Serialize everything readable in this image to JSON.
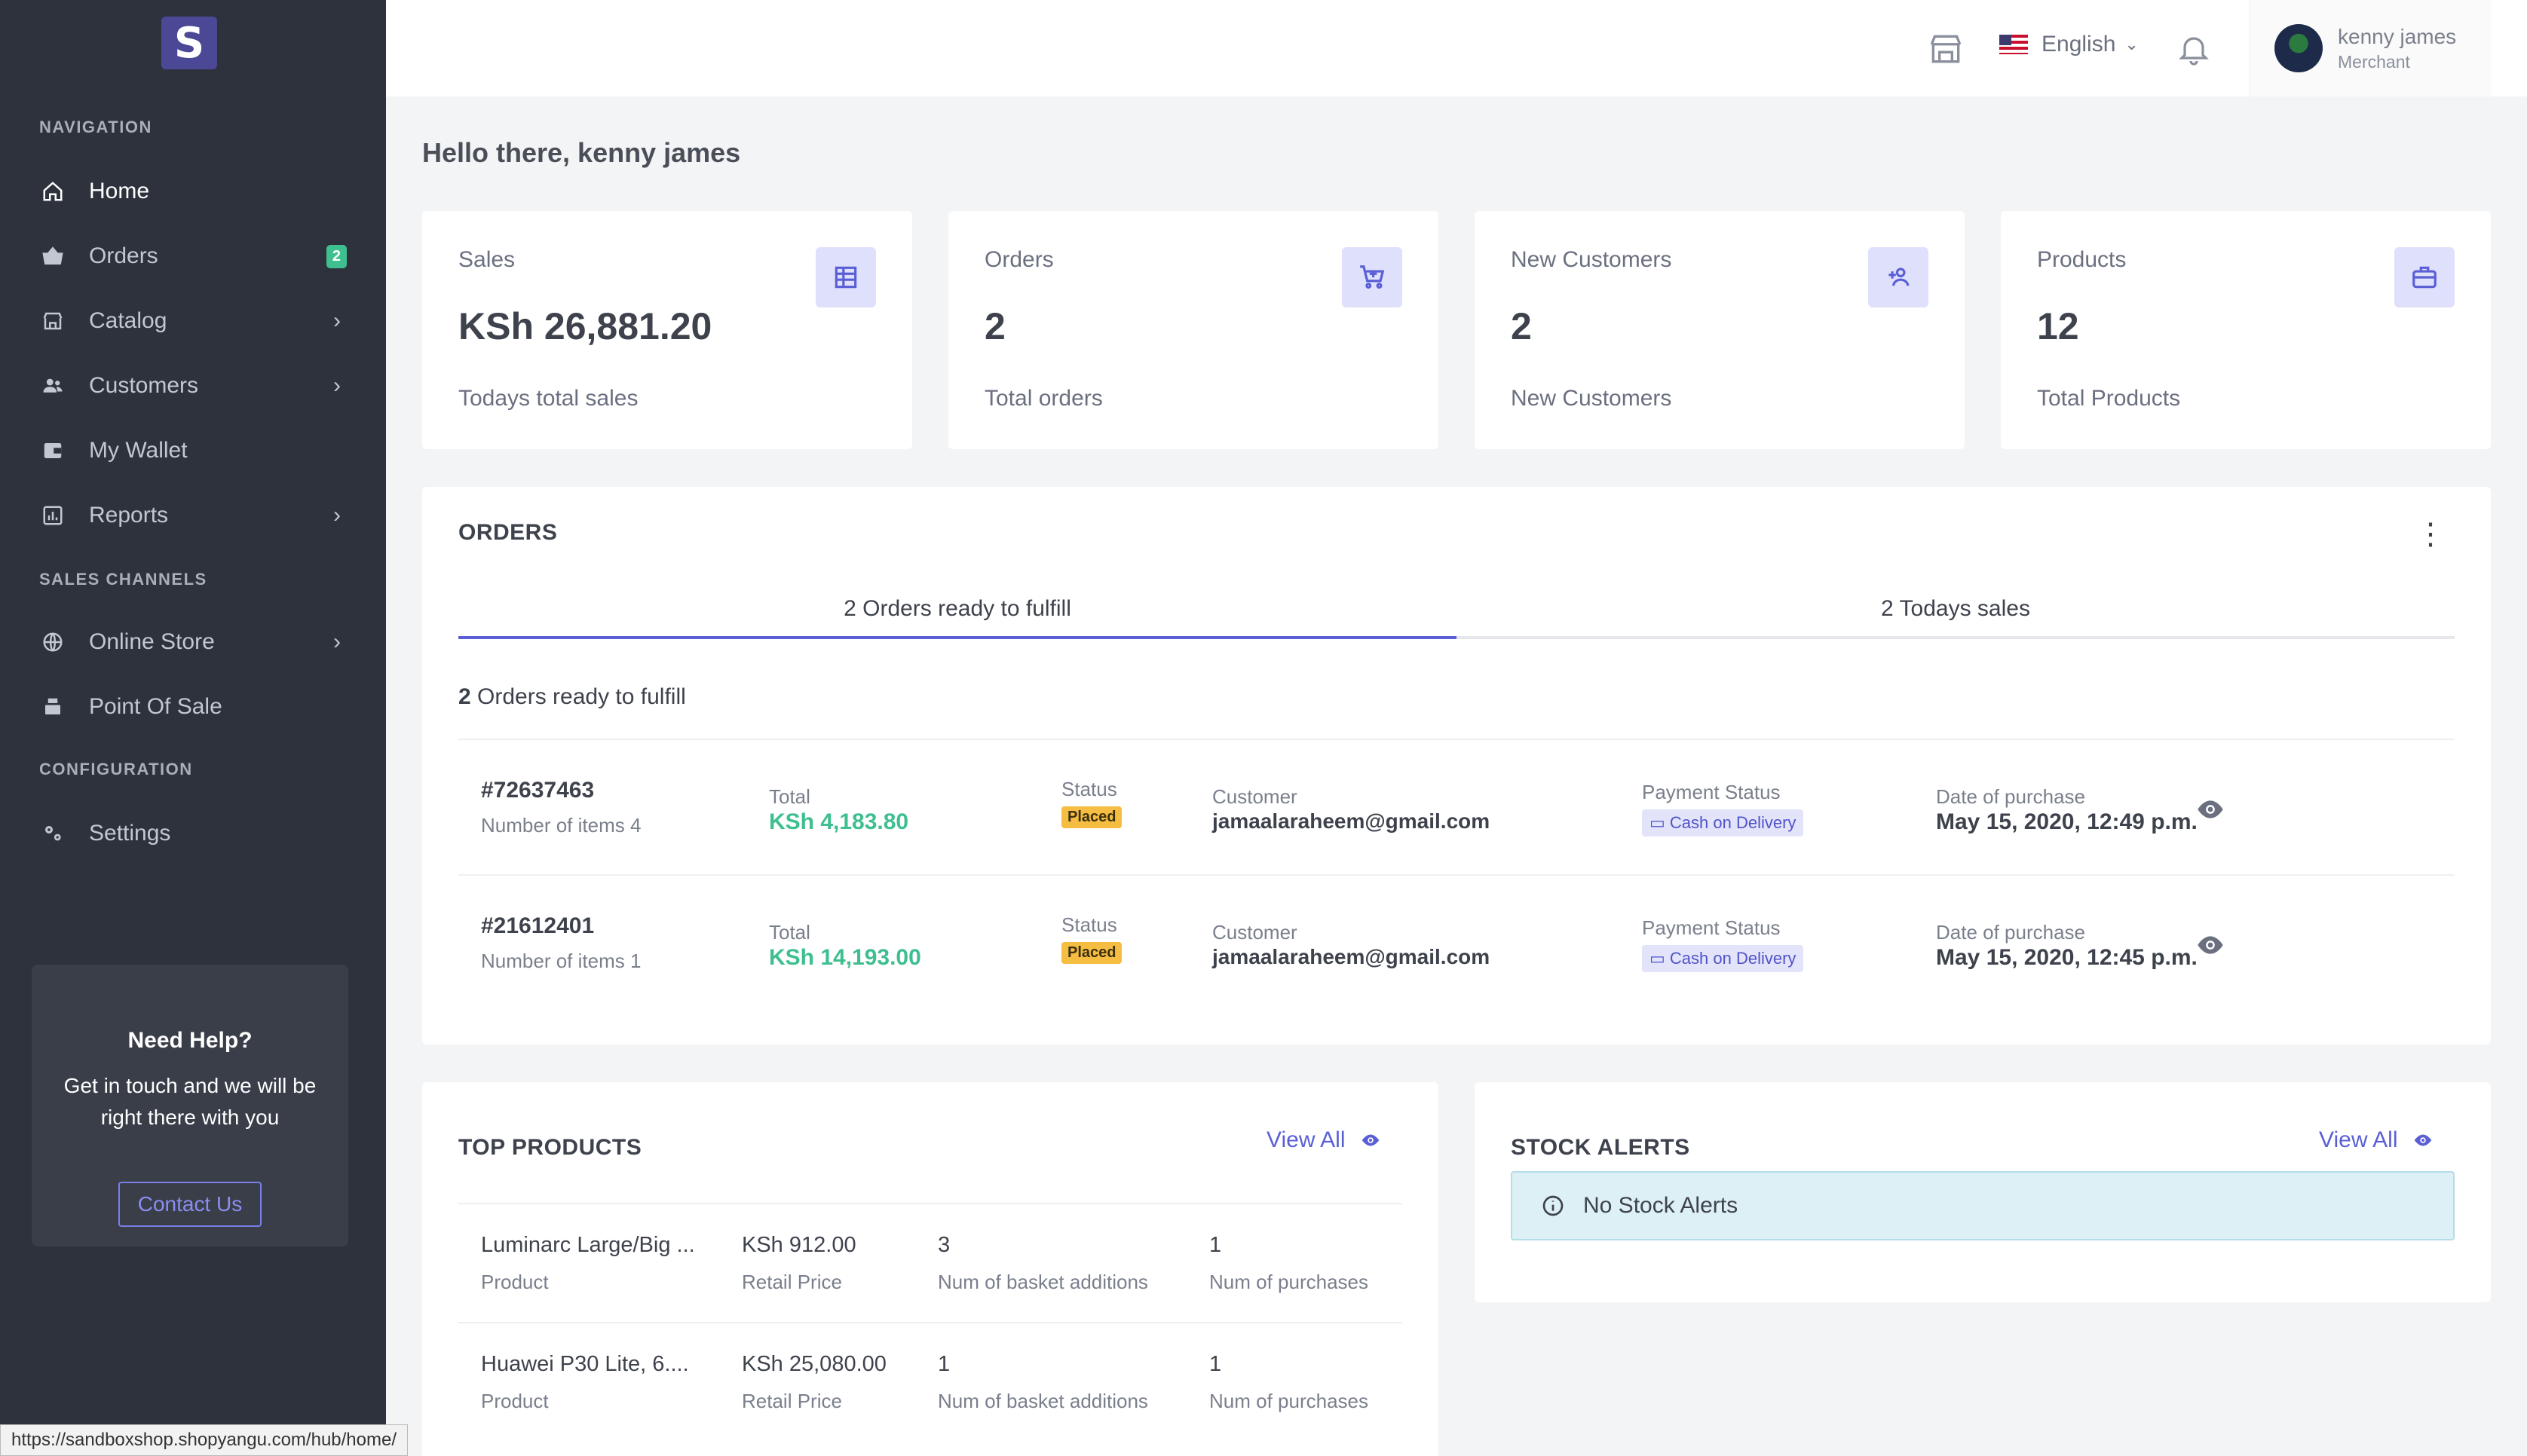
{
  "sidebar": {
    "logo_letter": "S",
    "sections": {
      "navigation": "NAVIGATION",
      "sales_channels": "SALES CHANNELS",
      "configuration": "CONFIGURATION"
    },
    "items": {
      "home": "Home",
      "orders": "Orders",
      "orders_badge": "2",
      "catalog": "Catalog",
      "customers": "Customers",
      "wallet": "My Wallet",
      "reports": "Reports",
      "online_store": "Online Store",
      "pos": "Point Of Sale",
      "settings": "Settings"
    },
    "help": {
      "title": "Need Help?",
      "text": "Get in touch and we will be right there with you",
      "button": "Contact Us"
    }
  },
  "status_url": "https://sandboxshop.shopyangu.com/hub/home/",
  "topbar": {
    "language": "English",
    "user_name": "kenny james",
    "user_role": "Merchant"
  },
  "greeting": "Hello there, kenny james",
  "stats": [
    {
      "label": "Sales",
      "value": "KSh 26,881.20",
      "sub": "Todays total sales",
      "icon": "ledger-icon"
    },
    {
      "label": "Orders",
      "value": "2",
      "sub": "Total orders",
      "icon": "cart-icon"
    },
    {
      "label": "New Customers",
      "value": "2",
      "sub": "New Customers",
      "icon": "users-icon"
    },
    {
      "label": "Products",
      "value": "12",
      "sub": "Total Products",
      "icon": "briefcase-icon"
    }
  ],
  "orders": {
    "title": "ORDERS",
    "tabs": [
      "2 Orders ready to fulfill",
      "2 Todays sales"
    ],
    "ready_count": "2",
    "ready_text": "Orders ready to fulfill",
    "labels": {
      "total": "Total",
      "status": "Status",
      "customer": "Customer",
      "payment_status": "Payment Status",
      "date": "Date of purchase"
    },
    "rows": [
      {
        "id": "#72637463",
        "items": "Number of items 4",
        "total": "KSh 4,183.80",
        "status": "Placed",
        "customer": "jamaalaraheem@gmail.com",
        "payment": "Cash on Delivery",
        "date": "May 15, 2020, 12:49 p.m."
      },
      {
        "id": "#21612401",
        "items": "Number of items 1",
        "total": "KSh 14,193.00",
        "status": "Placed",
        "customer": "jamaalaraheem@gmail.com",
        "payment": "Cash on Delivery",
        "date": "May 15, 2020, 12:45 p.m."
      }
    ]
  },
  "top_products": {
    "title": "TOP PRODUCTS",
    "view_all": "View All",
    "labels": {
      "product": "Product",
      "price": "Retail Price",
      "basket": "Num of basket additions",
      "purchases": "Num of purchases"
    },
    "rows": [
      {
        "name": "Luminarc Large/Big ...",
        "price": "KSh 912.00",
        "basket": "3",
        "purchases": "1"
      },
      {
        "name": "Huawei P30 Lite, 6....",
        "price": "KSh 25,080.00",
        "basket": "1",
        "purchases": "1"
      }
    ]
  },
  "stock_alerts": {
    "title": "STOCK ALERTS",
    "view_all": "View All",
    "message": "No Stock Alerts"
  },
  "colors": {
    "sidebar": "#2e323d",
    "accent": "#5b5fd6",
    "success": "#3fbf8f",
    "warning": "#f5bd41"
  }
}
